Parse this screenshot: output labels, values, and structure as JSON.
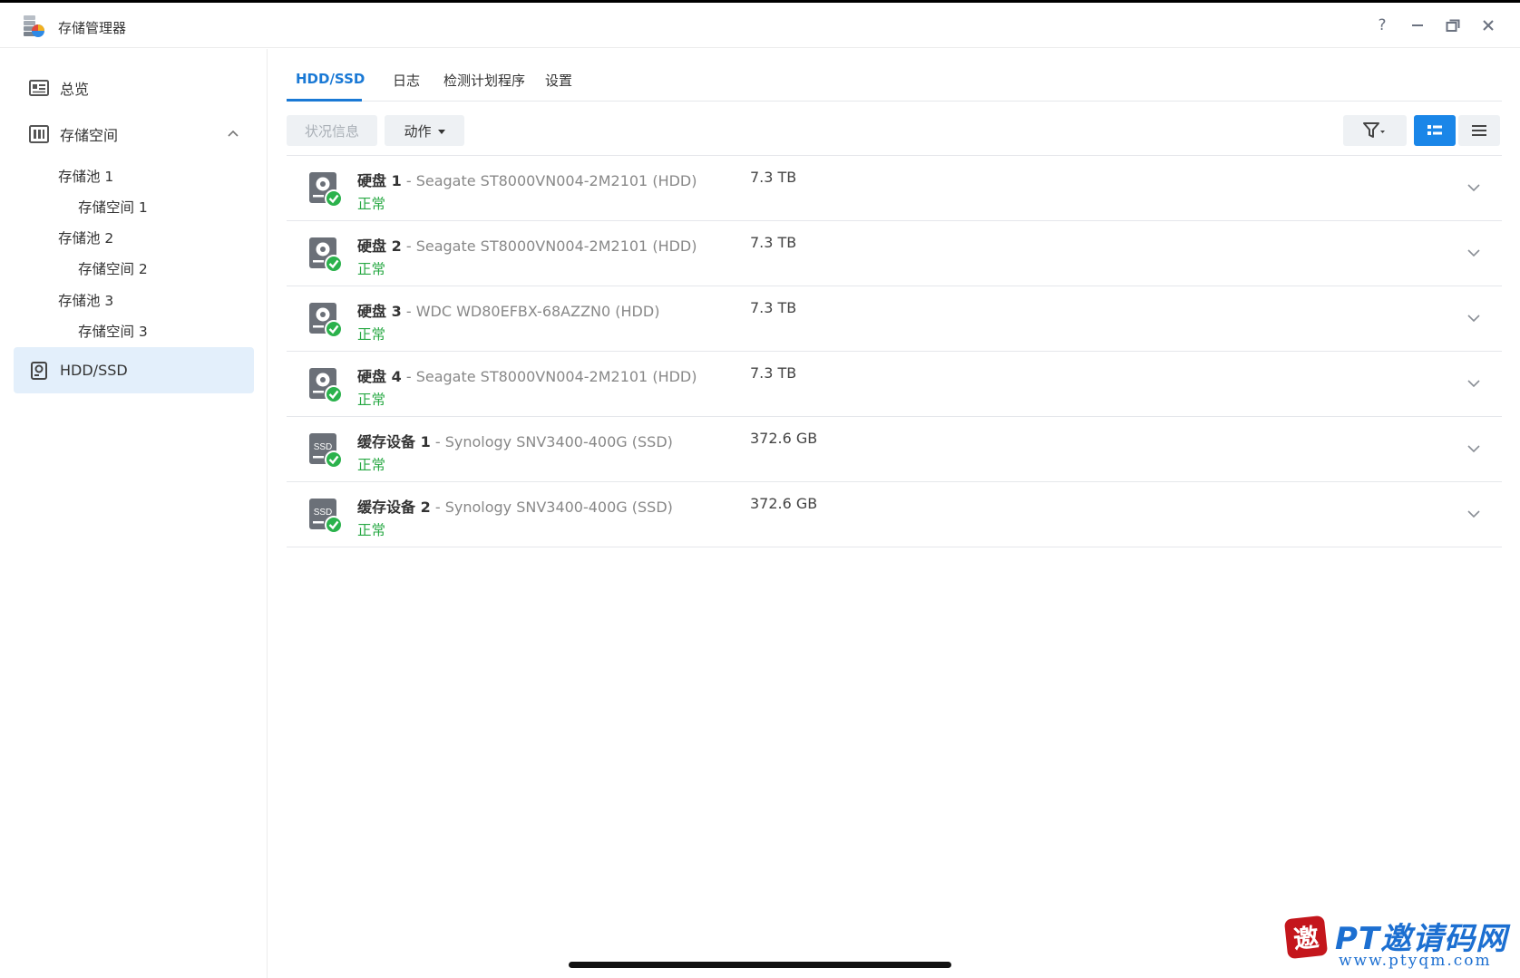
{
  "window": {
    "title": "存储管理器",
    "controls": [
      "?",
      "—",
      "restore",
      "×"
    ]
  },
  "sidebar": {
    "overview_label": "总览",
    "storage_label": "存储空间",
    "pools": [
      {
        "label": "存储池 1",
        "volume": "存储空间 1"
      },
      {
        "label": "存储池 2",
        "volume": "存储空间 2"
      },
      {
        "label": "存储池 3",
        "volume": "存储空间 3"
      }
    ],
    "hddssd_label": "HDD/SSD"
  },
  "tabs": [
    "HDD/SSD",
    "日志",
    "检测计划程序",
    "设置"
  ],
  "toolbar": {
    "status_label": "状况信息",
    "action_label": "动作"
  },
  "disks": [
    {
      "kind": "hdd",
      "label": "硬盘",
      "num": "1",
      "model": "Seagate ST8000VN004-2M2101 (HDD)",
      "status": "正常",
      "size": "7.3 TB"
    },
    {
      "kind": "hdd",
      "label": "硬盘",
      "num": "2",
      "model": "Seagate ST8000VN004-2M2101 (HDD)",
      "status": "正常",
      "size": "7.3 TB"
    },
    {
      "kind": "hdd",
      "label": "硬盘",
      "num": "3",
      "model": "WDC WD80EFBX-68AZZN0 (HDD)",
      "status": "正常",
      "size": "7.3 TB"
    },
    {
      "kind": "hdd",
      "label": "硬盘",
      "num": "4",
      "model": "Seagate ST8000VN004-2M2101 (HDD)",
      "status": "正常",
      "size": "7.3 TB"
    },
    {
      "kind": "ssd",
      "label": "缓存设备",
      "num": "1",
      "model": "Synology SNV3400-400G (SSD)",
      "status": "正常",
      "size": "372.6 GB"
    },
    {
      "kind": "ssd",
      "label": "缓存设备",
      "num": "2",
      "model": "Synology SNV3400-400G (SSD)",
      "status": "正常",
      "size": "372.6 GB"
    }
  ],
  "ssd_icon_text": "SSD",
  "watermark": {
    "text": "PT邀请码网",
    "url": "www.ptyqm.com",
    "seal": "邀"
  },
  "colors": {
    "accent": "#1a79d5",
    "status_ok": "#27a843",
    "active_nav_bg": "#e3effb"
  }
}
